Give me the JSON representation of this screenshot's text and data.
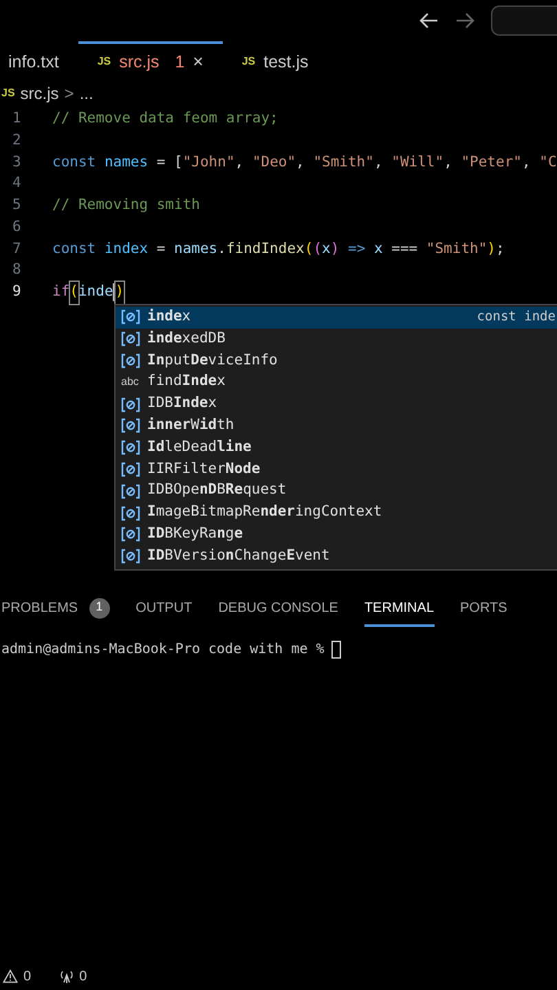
{
  "tabs": [
    {
      "label": "info.txt",
      "selected": false
    },
    {
      "label": "src.js",
      "icon_text": "JS",
      "selected": true,
      "problems": "1",
      "close": "×"
    },
    {
      "label": "test.js",
      "icon_text": "JS",
      "selected": false
    }
  ],
  "breadcrumb": {
    "icon_text": "JS",
    "file": "src.js",
    "separator": ">",
    "rest": "..."
  },
  "code_lines": [
    {
      "number": "1",
      "active": false,
      "tokens": [
        {
          "kind": "comment",
          "text": "// Remove data feom array;"
        }
      ]
    },
    {
      "number": "2",
      "active": false
    },
    {
      "number": "3",
      "active": false,
      "tokens": [
        {
          "kind": "keyword",
          "text": "const "
        },
        {
          "kind": "variable",
          "text": "names"
        },
        {
          "kind": "plain",
          "text": " = ["
        },
        {
          "kind": "string",
          "text": "\"John\""
        },
        {
          "kind": "plain",
          "text": ", "
        },
        {
          "kind": "string",
          "text": "\"Deo\""
        },
        {
          "kind": "plain",
          "text": ", "
        },
        {
          "kind": "string",
          "text": "\"Smith\""
        },
        {
          "kind": "plain",
          "text": ", "
        },
        {
          "kind": "string",
          "text": "\"Will\""
        },
        {
          "kind": "plain",
          "text": ", "
        },
        {
          "kind": "string",
          "text": "\"Peter\""
        },
        {
          "kind": "plain",
          "text": ", "
        },
        {
          "kind": "string",
          "text": "\"C"
        }
      ]
    },
    {
      "number": "4",
      "active": false
    },
    {
      "number": "5",
      "active": false,
      "tokens": [
        {
          "kind": "comment",
          "text": "// Removing smith"
        }
      ]
    },
    {
      "number": "6",
      "active": false
    },
    {
      "number": "7",
      "active": false,
      "tokens": [
        {
          "kind": "keyword",
          "text": "const "
        },
        {
          "kind": "variable",
          "text": "index"
        },
        {
          "kind": "plain",
          "text": " = "
        },
        {
          "kind": "name",
          "text": "names"
        },
        {
          "kind": "plain",
          "text": "."
        },
        {
          "kind": "function",
          "text": "findIndex"
        },
        {
          "kind": "bracket",
          "text": "("
        },
        {
          "kind": "bracket2",
          "text": "("
        },
        {
          "kind": "name",
          "text": "x"
        },
        {
          "kind": "bracket2",
          "text": ")"
        },
        {
          "kind": "keyword",
          "text": " => "
        },
        {
          "kind": "name",
          "text": "x"
        },
        {
          "kind": "plain",
          "text": " === "
        },
        {
          "kind": "string",
          "text": "\"Smith\""
        },
        {
          "kind": "bracket",
          "text": ")"
        },
        {
          "kind": "plain",
          "text": ";"
        }
      ]
    },
    {
      "number": "8",
      "active": false
    },
    {
      "number": "9",
      "active": true,
      "tokens": [
        {
          "kind": "control",
          "text": "if"
        },
        {
          "kind": "matched",
          "text": "("
        },
        {
          "kind": "name",
          "text": "inde"
        },
        {
          "kind": "cursor"
        },
        {
          "kind": "matched",
          "text": ")"
        }
      ]
    }
  ],
  "suggestions": [
    {
      "kind": "variable",
      "label": "**inde**x",
      "detail": "const inde",
      "selected": true
    },
    {
      "kind": "variable",
      "label": "**inde**xedDB",
      "selected": false
    },
    {
      "kind": "variable",
      "label": "**In**put**De**viceInfo",
      "selected": false
    },
    {
      "kind": "text",
      "icon_text": "abc",
      "label": "find**Inde**x",
      "selected": false
    },
    {
      "kind": "variable",
      "label": "IDB**Inde**x",
      "selected": false
    },
    {
      "kind": "variable",
      "label": "**inner**W**id**th",
      "selected": false
    },
    {
      "kind": "variable",
      "label": "**Id**leDead**line**",
      "selected": false
    },
    {
      "kind": "variable",
      "label": "IIRFilter**Node**",
      "selected": false
    },
    {
      "kind": "variable",
      "label": "IDBOpe**nD**B**Re**quest",
      "selected": false
    },
    {
      "kind": "variable",
      "label": "**I**mageBitmapRe**nder**ingContext",
      "selected": false
    },
    {
      "kind": "variable",
      "label": "**ID**BKeyRa**n**g**e**",
      "selected": false
    },
    {
      "kind": "variable",
      "label": "**ID**BVersio**n**Change**E**vent",
      "selected": false
    }
  ],
  "panel_tabs": [
    {
      "label": "PROBLEMS",
      "badge": "1",
      "selected": false
    },
    {
      "label": "OUTPUT",
      "selected": false
    },
    {
      "label": "DEBUG CONSOLE",
      "selected": false
    },
    {
      "label": "TERMINAL",
      "selected": true
    },
    {
      "label": "PORTS",
      "selected": false
    }
  ],
  "terminal": {
    "prompt": "admin@admins-MacBook-Pro code with me %"
  },
  "status_bar": [
    {
      "kind": "warnings",
      "count": "0"
    },
    {
      "kind": "ports",
      "count": "0"
    }
  ]
}
